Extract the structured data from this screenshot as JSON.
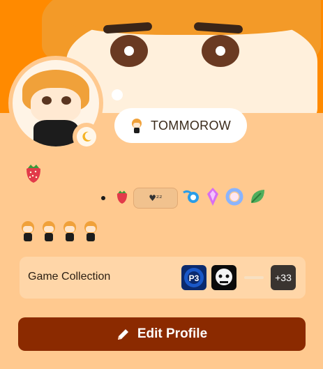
{
  "profile": {
    "status_text": "TOMMOROW",
    "status_icon": "chibi-avatar-icon",
    "activity_icon": "moon-icon"
  },
  "badges": [
    "strawberry-icon",
    "sleeping-heart-badge",
    "blue-orb-badge",
    "pink-crystal-badge",
    "blue-ring-badge",
    "green-leaf-badge"
  ],
  "sleep_badge": {
    "text": "♥ᶻᶻ"
  },
  "mutuals": [
    "mini-avatar",
    "mini-avatar",
    "mini-avatar",
    "mini-avatar"
  ],
  "game_collection": {
    "label": "Game Collection",
    "games": [
      "p3-game-icon",
      "skull-game-icon",
      "faded-game-icon"
    ],
    "more": "+33"
  },
  "edit_button": {
    "label": "Edit Profile",
    "icon": "pencil-icon"
  },
  "colors": {
    "banner": "#ff8a00",
    "card": "#ffc98f",
    "button": "#8b2a00"
  }
}
